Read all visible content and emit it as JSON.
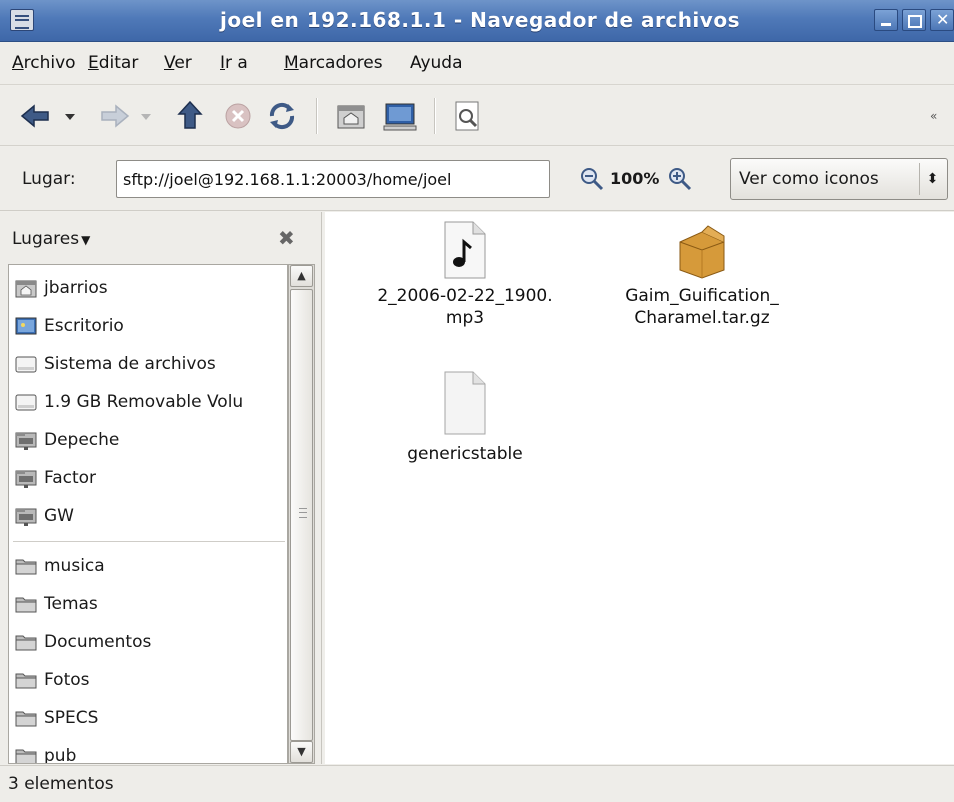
{
  "window": {
    "title": "joel en 192.168.1.1 - Navegador de archivos",
    "title_bg": "#4f79b8"
  },
  "menubar": [
    {
      "label": "Archivo",
      "accel": "A",
      "rest": "rchivo"
    },
    {
      "label": "Editar",
      "accel": "E",
      "rest": "ditar"
    },
    {
      "label": "Ver",
      "accel": "V",
      "rest": "er"
    },
    {
      "label": "Ir a",
      "accel": "I",
      "rest": "r a"
    },
    {
      "label": "Marcadores",
      "accel": "M",
      "rest": "arcadores"
    },
    {
      "label": "Ayuda",
      "accel": "",
      "rest": "Ayuda"
    }
  ],
  "toolbar": {
    "items": [
      "back-icon",
      "back-dropdown-icon",
      "forward-icon",
      "forward-dropdown-icon",
      "up-icon",
      "stop-icon",
      "reload-icon",
      "home-icon",
      "computer-icon",
      "search-icon"
    ]
  },
  "location": {
    "label": "Lugar:",
    "value": "sftp://joel@192.168.1.1:20003/home/joel",
    "zoom": "100%",
    "view_mode": "Ver como iconos"
  },
  "sidebar": {
    "title": "Lugares",
    "places": [
      {
        "label": "jbarrios",
        "icon": "home-folder-icon"
      },
      {
        "label": "Escritorio",
        "icon": "desktop-icon"
      },
      {
        "label": "Sistema de archivos",
        "icon": "drive-icon"
      },
      {
        "label": "1.9 GB Removable Volu",
        "icon": "drive-icon"
      },
      {
        "label": "Depeche",
        "icon": "network-folder-icon"
      },
      {
        "label": "Factor",
        "icon": "network-folder-icon"
      },
      {
        "label": "GW",
        "icon": "network-folder-icon"
      }
    ],
    "bookmarks": [
      {
        "label": "musica",
        "icon": "folder-icon"
      },
      {
        "label": "Temas",
        "icon": "folder-icon"
      },
      {
        "label": "Documentos",
        "icon": "folder-icon"
      },
      {
        "label": "Fotos",
        "icon": "folder-icon"
      },
      {
        "label": "SPECS",
        "icon": "folder-icon"
      },
      {
        "label": "pub",
        "icon": "folder-icon"
      }
    ]
  },
  "files": [
    {
      "line1": "2_2006-02-22_1900.",
      "line2": "mp3",
      "icon": "audio-file-icon"
    },
    {
      "line1": "Gaim_Guification_",
      "line2": "Charamel.tar.gz",
      "icon": "package-icon"
    },
    {
      "line1": "genericstable",
      "line2": "",
      "icon": "generic-file-icon"
    }
  ],
  "status": {
    "text": "3 elementos"
  }
}
